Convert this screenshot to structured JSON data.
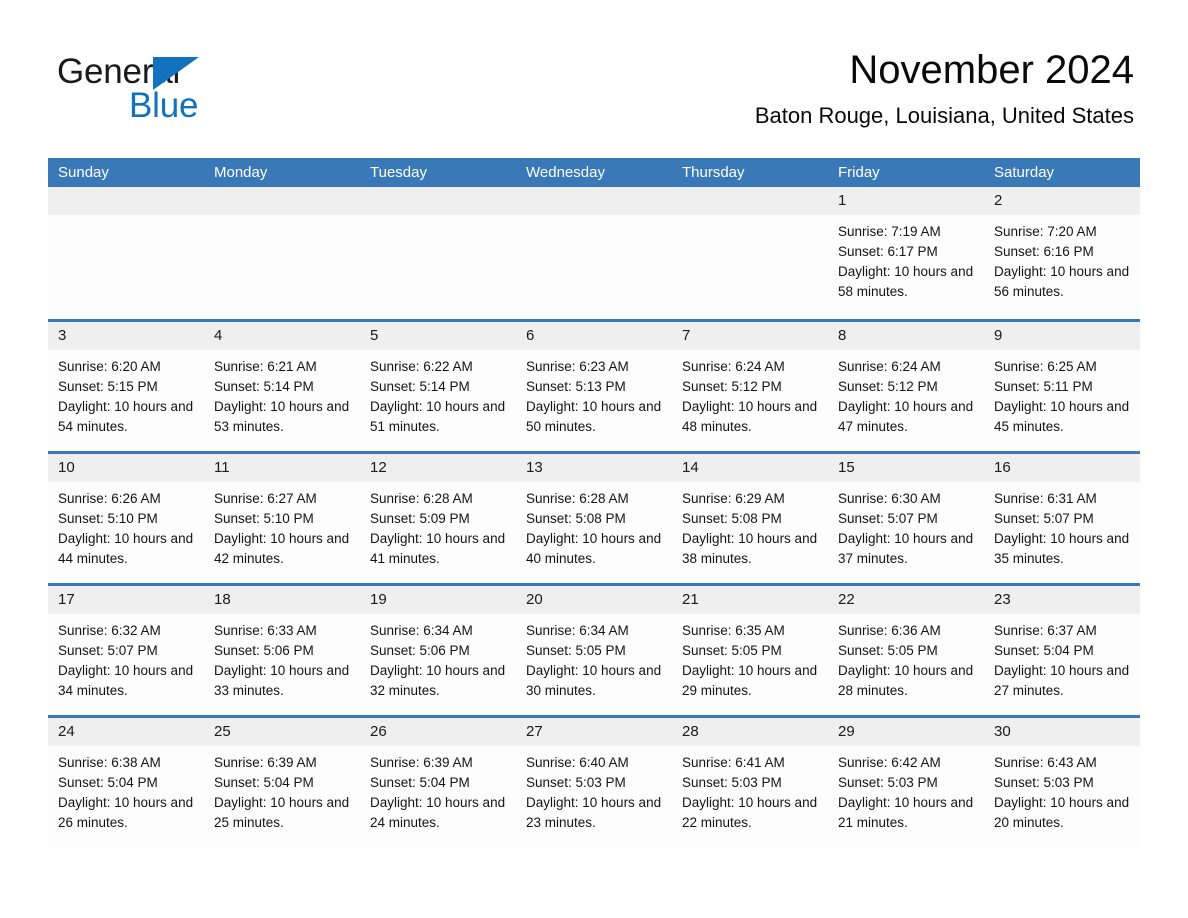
{
  "logo": {
    "text_primary": "General",
    "text_secondary": "Blue",
    "icon": "triangle-icon",
    "primary_color": "#1a1a1a",
    "accent_color": "#1272bd"
  },
  "header": {
    "title": "November 2024",
    "subtitle": "Baton Rouge, Louisiana, United States"
  },
  "theme": {
    "header_bg": "#3a79b8",
    "header_text": "#ffffff",
    "daynum_band_bg": "#efefef",
    "row_border": "#3a79b8",
    "cell_bg": "#fdfdfd",
    "text": "#141414"
  },
  "calendar": {
    "weekdays": [
      "Sunday",
      "Monday",
      "Tuesday",
      "Wednesday",
      "Thursday",
      "Friday",
      "Saturday"
    ],
    "weeks": [
      [
        {
          "day": "",
          "sunrise": "",
          "sunset": "",
          "daylight": ""
        },
        {
          "day": "",
          "sunrise": "",
          "sunset": "",
          "daylight": ""
        },
        {
          "day": "",
          "sunrise": "",
          "sunset": "",
          "daylight": ""
        },
        {
          "day": "",
          "sunrise": "",
          "sunset": "",
          "daylight": ""
        },
        {
          "day": "",
          "sunrise": "",
          "sunset": "",
          "daylight": ""
        },
        {
          "day": "1",
          "sunrise": "Sunrise: 7:19 AM",
          "sunset": "Sunset: 6:17 PM",
          "daylight": "Daylight: 10 hours and 58 minutes."
        },
        {
          "day": "2",
          "sunrise": "Sunrise: 7:20 AM",
          "sunset": "Sunset: 6:16 PM",
          "daylight": "Daylight: 10 hours and 56 minutes."
        }
      ],
      [
        {
          "day": "3",
          "sunrise": "Sunrise: 6:20 AM",
          "sunset": "Sunset: 5:15 PM",
          "daylight": "Daylight: 10 hours and 54 minutes."
        },
        {
          "day": "4",
          "sunrise": "Sunrise: 6:21 AM",
          "sunset": "Sunset: 5:14 PM",
          "daylight": "Daylight: 10 hours and 53 minutes."
        },
        {
          "day": "5",
          "sunrise": "Sunrise: 6:22 AM",
          "sunset": "Sunset: 5:14 PM",
          "daylight": "Daylight: 10 hours and 51 minutes."
        },
        {
          "day": "6",
          "sunrise": "Sunrise: 6:23 AM",
          "sunset": "Sunset: 5:13 PM",
          "daylight": "Daylight: 10 hours and 50 minutes."
        },
        {
          "day": "7",
          "sunrise": "Sunrise: 6:24 AM",
          "sunset": "Sunset: 5:12 PM",
          "daylight": "Daylight: 10 hours and 48 minutes."
        },
        {
          "day": "8",
          "sunrise": "Sunrise: 6:24 AM",
          "sunset": "Sunset: 5:12 PM",
          "daylight": "Daylight: 10 hours and 47 minutes."
        },
        {
          "day": "9",
          "sunrise": "Sunrise: 6:25 AM",
          "sunset": "Sunset: 5:11 PM",
          "daylight": "Daylight: 10 hours and 45 minutes."
        }
      ],
      [
        {
          "day": "10",
          "sunrise": "Sunrise: 6:26 AM",
          "sunset": "Sunset: 5:10 PM",
          "daylight": "Daylight: 10 hours and 44 minutes."
        },
        {
          "day": "11",
          "sunrise": "Sunrise: 6:27 AM",
          "sunset": "Sunset: 5:10 PM",
          "daylight": "Daylight: 10 hours and 42 minutes."
        },
        {
          "day": "12",
          "sunrise": "Sunrise: 6:28 AM",
          "sunset": "Sunset: 5:09 PM",
          "daylight": "Daylight: 10 hours and 41 minutes."
        },
        {
          "day": "13",
          "sunrise": "Sunrise: 6:28 AM",
          "sunset": "Sunset: 5:08 PM",
          "daylight": "Daylight: 10 hours and 40 minutes."
        },
        {
          "day": "14",
          "sunrise": "Sunrise: 6:29 AM",
          "sunset": "Sunset: 5:08 PM",
          "daylight": "Daylight: 10 hours and 38 minutes."
        },
        {
          "day": "15",
          "sunrise": "Sunrise: 6:30 AM",
          "sunset": "Sunset: 5:07 PM",
          "daylight": "Daylight: 10 hours and 37 minutes."
        },
        {
          "day": "16",
          "sunrise": "Sunrise: 6:31 AM",
          "sunset": "Sunset: 5:07 PM",
          "daylight": "Daylight: 10 hours and 35 minutes."
        }
      ],
      [
        {
          "day": "17",
          "sunrise": "Sunrise: 6:32 AM",
          "sunset": "Sunset: 5:07 PM",
          "daylight": "Daylight: 10 hours and 34 minutes."
        },
        {
          "day": "18",
          "sunrise": "Sunrise: 6:33 AM",
          "sunset": "Sunset: 5:06 PM",
          "daylight": "Daylight: 10 hours and 33 minutes."
        },
        {
          "day": "19",
          "sunrise": "Sunrise: 6:34 AM",
          "sunset": "Sunset: 5:06 PM",
          "daylight": "Daylight: 10 hours and 32 minutes."
        },
        {
          "day": "20",
          "sunrise": "Sunrise: 6:34 AM",
          "sunset": "Sunset: 5:05 PM",
          "daylight": "Daylight: 10 hours and 30 minutes."
        },
        {
          "day": "21",
          "sunrise": "Sunrise: 6:35 AM",
          "sunset": "Sunset: 5:05 PM",
          "daylight": "Daylight: 10 hours and 29 minutes."
        },
        {
          "day": "22",
          "sunrise": "Sunrise: 6:36 AM",
          "sunset": "Sunset: 5:05 PM",
          "daylight": "Daylight: 10 hours and 28 minutes."
        },
        {
          "day": "23",
          "sunrise": "Sunrise: 6:37 AM",
          "sunset": "Sunset: 5:04 PM",
          "daylight": "Daylight: 10 hours and 27 minutes."
        }
      ],
      [
        {
          "day": "24",
          "sunrise": "Sunrise: 6:38 AM",
          "sunset": "Sunset: 5:04 PM",
          "daylight": "Daylight: 10 hours and 26 minutes."
        },
        {
          "day": "25",
          "sunrise": "Sunrise: 6:39 AM",
          "sunset": "Sunset: 5:04 PM",
          "daylight": "Daylight: 10 hours and 25 minutes."
        },
        {
          "day": "26",
          "sunrise": "Sunrise: 6:39 AM",
          "sunset": "Sunset: 5:04 PM",
          "daylight": "Daylight: 10 hours and 24 minutes."
        },
        {
          "day": "27",
          "sunrise": "Sunrise: 6:40 AM",
          "sunset": "Sunset: 5:03 PM",
          "daylight": "Daylight: 10 hours and 23 minutes."
        },
        {
          "day": "28",
          "sunrise": "Sunrise: 6:41 AM",
          "sunset": "Sunset: 5:03 PM",
          "daylight": "Daylight: 10 hours and 22 minutes."
        },
        {
          "day": "29",
          "sunrise": "Sunrise: 6:42 AM",
          "sunset": "Sunset: 5:03 PM",
          "daylight": "Daylight: 10 hours and 21 minutes."
        },
        {
          "day": "30",
          "sunrise": "Sunrise: 6:43 AM",
          "sunset": "Sunset: 5:03 PM",
          "daylight": "Daylight: 10 hours and 20 minutes."
        }
      ]
    ]
  }
}
